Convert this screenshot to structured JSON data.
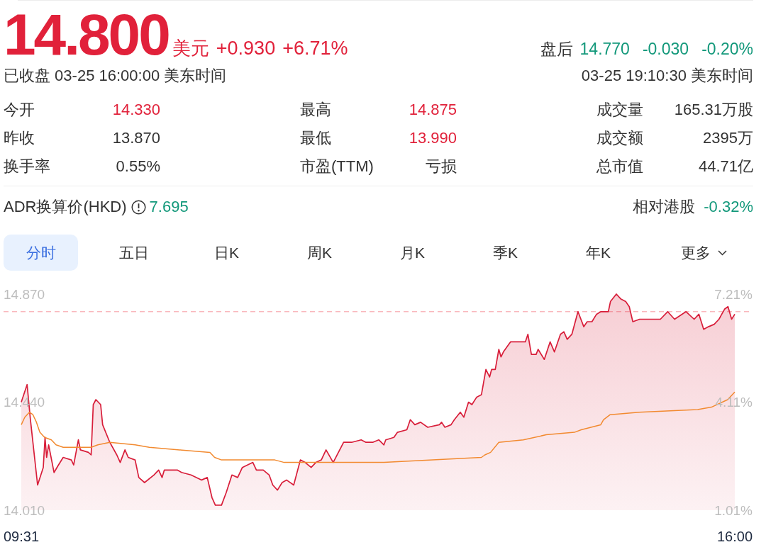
{
  "quote": {
    "price": "14.800",
    "currency": "美元",
    "change": "+0.930",
    "change_percent": "+6.71%",
    "up": true,
    "status": "已收盘 03-25 16:00:00 美东时间"
  },
  "after_hours": {
    "label": "盘后",
    "price": "14.770",
    "change": "-0.030",
    "change_percent": "-0.20%",
    "up": false,
    "time": "03-25 19:10:30 美东时间"
  },
  "stats": [
    {
      "label": "今开",
      "value": "14.330",
      "color": "#e1213a"
    },
    {
      "label": "最高",
      "value": "14.875",
      "color": "#e1213a"
    },
    {
      "label": "成交量",
      "value": "165.31万股",
      "color": "#333333"
    },
    {
      "label": "昨收",
      "value": "13.870",
      "color": "#333333"
    },
    {
      "label": "最低",
      "value": "13.990",
      "color": "#e1213a"
    },
    {
      "label": "成交额",
      "value": "2395万",
      "color": "#333333"
    },
    {
      "label": "换手率",
      "value": "0.55%",
      "color": "#333333"
    },
    {
      "label": "市盈(TTM)",
      "value": "亏损",
      "color": "#333333"
    },
    {
      "label": "总市值",
      "value": "44.71亿",
      "color": "#333333"
    }
  ],
  "adr": {
    "label": "ADR换算价(HKD)",
    "value": "7.695",
    "up": false
  },
  "relative": {
    "label": "相对港股",
    "value": "-0.32%",
    "up": false
  },
  "tabs": [
    {
      "label": "分时",
      "selected": true,
      "kind": "tab"
    },
    {
      "label": "五日",
      "selected": false,
      "kind": "tab"
    },
    {
      "label": "日K",
      "selected": false,
      "kind": "tab"
    },
    {
      "label": "周K",
      "selected": false,
      "kind": "tab"
    },
    {
      "label": "月K",
      "selected": false,
      "kind": "tab"
    },
    {
      "label": "季K",
      "selected": false,
      "kind": "tab"
    },
    {
      "label": "年K",
      "selected": false,
      "kind": "tab"
    },
    {
      "label": "更多",
      "selected": false,
      "kind": "menu"
    }
  ],
  "chart": {
    "chart_data": [
      {
        "type": "line",
        "xlim": [
          9.517,
          16
        ],
        "xticks": [
          {
            "value": 9.517,
            "label": "09:31"
          },
          {
            "value": 16,
            "label": "16:00"
          }
        ],
        "ylim": [
          14.01,
          14.87
        ],
        "yticks": [
          {
            "value": 14.01,
            "label": "14.010"
          },
          {
            "value": 14.44,
            "label": "14.440"
          },
          {
            "value": 14.87,
            "label": "14.870"
          }
        ],
        "y2lim": [
          1.01,
          7.21
        ],
        "y2ticks": [
          {
            "value": 1.01,
            "label": "1.01%"
          },
          {
            "value": 4.11,
            "label": "4.11%"
          },
          {
            "value": 7.21,
            "label": "7.21%"
          }
        ],
        "ref_lines": [
          {
            "axis": "y",
            "value": 14.8,
            "color": "#f9b8bd",
            "line_style": "dashed"
          }
        ],
        "series": [
          {
            "type": "area",
            "color": "#d81e3a",
            "x": [
              9.517,
              9.57,
              9.6,
              9.665,
              9.717,
              9.733,
              9.747,
              9.766,
              9.815,
              9.855,
              9.898,
              9.972,
              9.993,
              10.036,
              10.054,
              10.127,
              10.152,
              10.171,
              10.195,
              10.238,
              10.256,
              10.321,
              10.385,
              10.416,
              10.459,
              10.489,
              10.551,
              10.585,
              10.637,
              10.722,
              10.765,
              10.796,
              10.817,
              10.934,
              10.974,
              11.059,
              11.156,
              11.207,
              11.25,
              11.28,
              11.336,
              11.379,
              11.431,
              11.483,
              11.526,
              11.621,
              11.653,
              11.716,
              11.769,
              11.802,
              11.845,
              11.887,
              11.927,
              11.992,
              12.053,
              12.096,
              12.151,
              12.194,
              12.243,
              12.286,
              12.351,
              12.446,
              12.519,
              12.605,
              12.648,
              12.71,
              12.765,
              12.812,
              12.829,
              12.903,
              12.935,
              13.02,
              13.052,
              13.093,
              13.145,
              13.21,
              13.316,
              13.336,
              13.366,
              13.422,
              13.452,
              13.506,
              13.538,
              13.581,
              13.612,
              13.655,
              13.698,
              13.739,
              13.772,
              13.79,
              13.824,
              13.856,
              13.876,
              13.898,
              13.962,
              14.097,
              14.12,
              14.152,
              14.195,
              14.213,
              14.269,
              14.322,
              14.361,
              14.416,
              14.447,
              14.477,
              14.52,
              14.575,
              14.628,
              14.659,
              14.702,
              14.744,
              14.784,
              14.851,
              14.87,
              14.924,
              14.966,
              15.009,
              15.041,
              15.073,
              15.136,
              15.242,
              15.324,
              15.39,
              15.453,
              15.557,
              15.631,
              15.674,
              15.717,
              15.76,
              15.813,
              15.856,
              15.907,
              15.938,
              15.971,
              16.0
            ],
            "values": [
              14.44,
              14.51,
              14.37,
              14.11,
              14.18,
              14.3,
              14.22,
              14.27,
              14.16,
              14.19,
              14.22,
              14.21,
              14.19,
              14.29,
              14.25,
              14.24,
              14.23,
              14.43,
              14.45,
              14.43,
              14.35,
              14.28,
              14.23,
              14.2,
              14.25,
              14.22,
              14.21,
              14.14,
              14.12,
              14.15,
              14.17,
              14.14,
              14.17,
              14.17,
              14.16,
              14.15,
              14.13,
              14.14,
              14.06,
              14.03,
              14.03,
              14.08,
              14.15,
              14.14,
              14.18,
              14.2,
              14.17,
              14.17,
              14.15,
              14.11,
              14.09,
              14.12,
              14.13,
              14.11,
              14.21,
              14.2,
              14.18,
              14.2,
              14.21,
              14.25,
              14.2,
              14.28,
              14.28,
              14.29,
              14.28,
              14.28,
              14.29,
              14.27,
              14.29,
              14.3,
              14.32,
              14.33,
              14.37,
              14.35,
              14.36,
              14.34,
              14.35,
              14.36,
              14.34,
              14.35,
              14.37,
              14.4,
              14.38,
              14.44,
              14.43,
              14.46,
              14.47,
              14.57,
              14.54,
              14.57,
              14.57,
              14.65,
              14.62,
              14.64,
              14.68,
              14.68,
              14.71,
              14.63,
              14.63,
              14.65,
              14.61,
              14.68,
              14.64,
              14.71,
              14.72,
              14.69,
              14.71,
              14.8,
              14.74,
              14.76,
              14.76,
              14.79,
              14.8,
              14.8,
              14.84,
              14.87,
              14.85,
              14.84,
              14.82,
              14.76,
              14.77,
              14.77,
              14.77,
              14.8,
              14.77,
              14.8,
              14.77,
              14.79,
              14.73,
              14.74,
              14.75,
              14.77,
              14.81,
              14.82,
              14.77,
              14.79
            ]
          },
          {
            "type": "line",
            "color": "#f28a30",
            "x": [
              9.517,
              9.549,
              9.591,
              9.623,
              9.655,
              9.686,
              9.729,
              9.79,
              9.833,
              9.898,
              10.023,
              10.152,
              10.213,
              10.321,
              10.551,
              10.68,
              10.956,
              11.231,
              11.274,
              11.336,
              11.526,
              11.821,
              11.906,
              12.812,
              13.698,
              13.729,
              13.781,
              13.856,
              14.078,
              14.286,
              14.543,
              14.605,
              14.782,
              14.807,
              14.868,
              15.132,
              15.662,
              15.788,
              15.935,
              16.0
            ],
            "values": [
              14.35,
              14.38,
              14.4,
              14.39,
              14.36,
              14.32,
              14.3,
              14.29,
              14.27,
              14.26,
              14.26,
              14.26,
              14.27,
              14.28,
              14.27,
              14.26,
              14.25,
              14.24,
              14.22,
              14.21,
              14.21,
              14.21,
              14.2,
              14.2,
              14.22,
              14.23,
              14.24,
              14.28,
              14.29,
              14.31,
              14.32,
              14.33,
              14.35,
              14.37,
              14.39,
              14.4,
              14.41,
              14.42,
              14.45,
              14.48
            ]
          }
        ]
      }
    ]
  }
}
